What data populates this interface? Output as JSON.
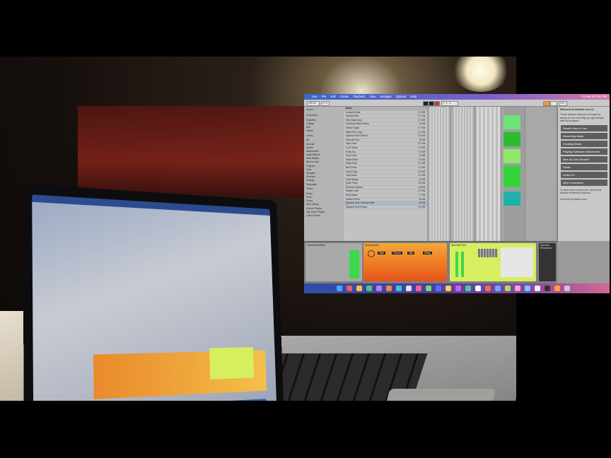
{
  "colors": {
    "accent_green": "#3cd84a",
    "accent_orange": "#f39a2a",
    "accent_yellow": "#e0f35a",
    "teal": "#22b5a5"
  },
  "menubar": {
    "apple": "",
    "items": [
      "Live",
      "File",
      "Edit",
      "Create",
      "Playback",
      "View",
      "Navigate",
      "Options",
      "Help"
    ],
    "clock": "Fri Mar 28 4:51 PM"
  },
  "toolbar": {
    "tempo": "120.00",
    "signature": "4 / 4",
    "bars": "1 . 1 . 1",
    "key": "Key",
    "midi": "MIDI",
    "cpu": "3 %"
  },
  "browser": {
    "search_placeholder": "Search",
    "collections_header": "Collections",
    "collections": [
      "Favorites",
      "Orange",
      "Red",
      "Yellow"
    ],
    "library_header": "Library",
    "library": [
      "All",
      "Sounds",
      "Drums",
      "Instruments",
      "Audio Effects",
      "MIDI Effects",
      "Max for Live",
      "Plug-Ins",
      "Clips",
      "Samples",
      "Grooves",
      "Tunings",
      "Templates"
    ],
    "places_header": "Places",
    "places": [
      "Packs",
      "Push",
      "Cloud",
      "User Library",
      "Current Project",
      "Tap Three Project",
      "Lost & Found"
    ]
  },
  "filelist": {
    "header": "Name",
    "items": [
      {
        "name": "Soothed Hihat",
        "size": "3.2 KB"
      },
      {
        "name": "Spectral Blur",
        "size": "5.1 KB"
      },
      {
        "name": "Kick Glass Drop",
        "size": "2.4 KB"
      },
      {
        "name": "Cinematic Bass Sweep",
        "size": "12 KB"
      },
      {
        "name": "Hollow Organ",
        "size": "8.7 KB"
      },
      {
        "name": "Metal Perc Loop",
        "size": "4.4 KB"
      },
      {
        "name": "Spectral Time Texture",
        "size": "9.9 KB"
      },
      {
        "name": "Granular Pad",
        "size": "15 KB"
      },
      {
        "name": "Tape Lead",
        "size": "6.2 KB"
      },
      {
        "name": "Lo-Fi Snare",
        "size": "2.8 KB"
      },
      {
        "name": "Pulse Arp",
        "size": "7.0 KB"
      },
      {
        "name": "Sub Drone",
        "size": "11 KB"
      },
      {
        "name": "Noise Swell",
        "size": "3.9 KB"
      },
      {
        "name": "Glass Keys",
        "size": "6.6 KB"
      },
      {
        "name": "Bell Chime",
        "size": "4.1 KB"
      },
      {
        "name": "Vocal Chop",
        "size": "5.5 KB"
      },
      {
        "name": "Clap Room",
        "size": "2.2 KB"
      },
      {
        "name": "Dark Strings",
        "size": "13 KB"
      },
      {
        "name": "Synth Pluck",
        "size": "3.6 KB"
      },
      {
        "name": "Reverse Cymbal",
        "size": "4.8 KB"
      },
      {
        "name": "Shaker Loop",
        "size": "2.9 KB"
      },
      {
        "name": "Warm Bass",
        "size": "7.7 KB"
      },
      {
        "name": "Ambient Field",
        "size": "16 KB"
      },
      {
        "name": "Spectral Time Granular Shift",
        "size": "10 KB"
      },
      {
        "name": "Spectral Time Freeze",
        "size": "9.3 KB"
      }
    ]
  },
  "info": {
    "title": "Welcome to Ableton Live 12",
    "intro": "These lessons walk you through the basics of Live and help you get familiar with the program.",
    "lessons": [
      "What's New in Live",
      "Recording Audio",
      "Creating Beats",
      "Playing Software Instruments",
      "Max for Live Devices",
      "Packs",
      "Audio I/O",
      "MIDI Controllers"
    ],
    "foot1": "To learn more about Live, consult the Ableton Reference Manual.",
    "foot2": "Get help at ableton.com"
  },
  "devices": {
    "d1": "Instrument Rack",
    "d2": "Spectral Blur",
    "d3": "Spectral Time",
    "d4": "Spectral Resonator",
    "knobs": [
      "Halo",
      "Freeze",
      "Wet",
      "Delay",
      "Blur"
    ]
  }
}
